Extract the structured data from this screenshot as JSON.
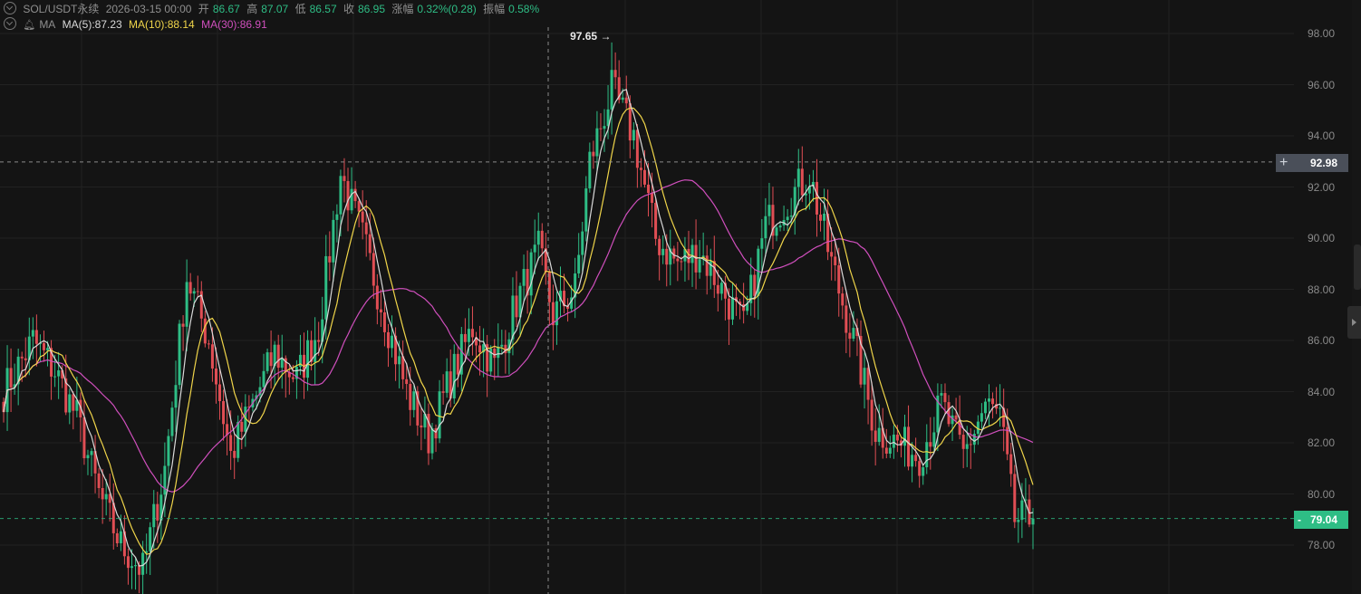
{
  "header": {
    "symbol": "SOL/USDT永续",
    "datetime": "2026-03-15 00:00",
    "open_label": "开",
    "open": "86.67",
    "high_label": "高",
    "high": "87.07",
    "low_label": "低",
    "low": "86.57",
    "close_label": "收",
    "close": "86.95",
    "change_label": "涨幅",
    "change": "0.32%(0.28)",
    "amplitude_label": "振幅",
    "amplitude": "0.58%"
  },
  "indicators": {
    "name": "MA",
    "ma5": "MA(5):87.23",
    "ma10": "MA(10):88.14",
    "ma30": "MA(30):86.91"
  },
  "colors": {
    "up": "#2ebd85",
    "down": "#e04e54",
    "ma5": "#d9d9d9",
    "ma10": "#f0d54a",
    "ma30": "#d04fbd",
    "grid": "#222222",
    "background": "#141414"
  },
  "markers": {
    "peak_label": "97.65 →",
    "crosshair_price": "92.98",
    "last_price": "79.04"
  },
  "chart_data": {
    "type": "candlestick",
    "ylim": [
      75.5,
      99.5
    ],
    "y_ticks": [
      "98.00",
      "96.00",
      "94.00",
      "92.00",
      "90.00",
      "88.00",
      "86.00",
      "84.00",
      "82.00",
      "80.00",
      "78.00"
    ],
    "grid": true,
    "crosshair": {
      "price": 92.98
    },
    "last_price": 79.04,
    "high_marker": 97.65,
    "anchors": [
      [
        0,
        84.0
      ],
      [
        8,
        86.0
      ],
      [
        14,
        84.8
      ],
      [
        20,
        83.0
      ],
      [
        26,
        80.0
      ],
      [
        32,
        78.0
      ],
      [
        38,
        77.0
      ],
      [
        44,
        81.0
      ],
      [
        50,
        88.5
      ],
      [
        56,
        86.0
      ],
      [
        62,
        81.5
      ],
      [
        68,
        83.5
      ],
      [
        74,
        85.5
      ],
      [
        80,
        84.5
      ],
      [
        86,
        86.5
      ],
      [
        92,
        92.5
      ],
      [
        98,
        90.0
      ],
      [
        104,
        87.0
      ],
      [
        110,
        84.0
      ],
      [
        116,
        82.2
      ],
      [
        122,
        84.5
      ],
      [
        128,
        86.5
      ],
      [
        134,
        85.0
      ],
      [
        140,
        87.5
      ],
      [
        146,
        89.5
      ],
      [
        150,
        87.0
      ],
      [
        156,
        88.0
      ],
      [
        160,
        93.0
      ],
      [
        166,
        95.8
      ],
      [
        172,
        94.0
      ],
      [
        178,
        90.0
      ],
      [
        184,
        89.0
      ],
      [
        190,
        89.5
      ],
      [
        196,
        88.0
      ],
      [
        202,
        86.5
      ],
      [
        208,
        90.5
      ],
      [
        214,
        91.5
      ],
      [
        220,
        92.5
      ],
      [
        226,
        89.0
      ],
      [
        232,
        86.0
      ],
      [
        238,
        82.5
      ],
      [
        244,
        82.0
      ],
      [
        250,
        81.5
      ],
      [
        256,
        83.5
      ],
      [
        262,
        81.5
      ],
      [
        268,
        83.5
      ],
      [
        272,
        83.0
      ],
      [
        276,
        79.0
      ],
      [
        281,
        79.04
      ]
    ]
  }
}
